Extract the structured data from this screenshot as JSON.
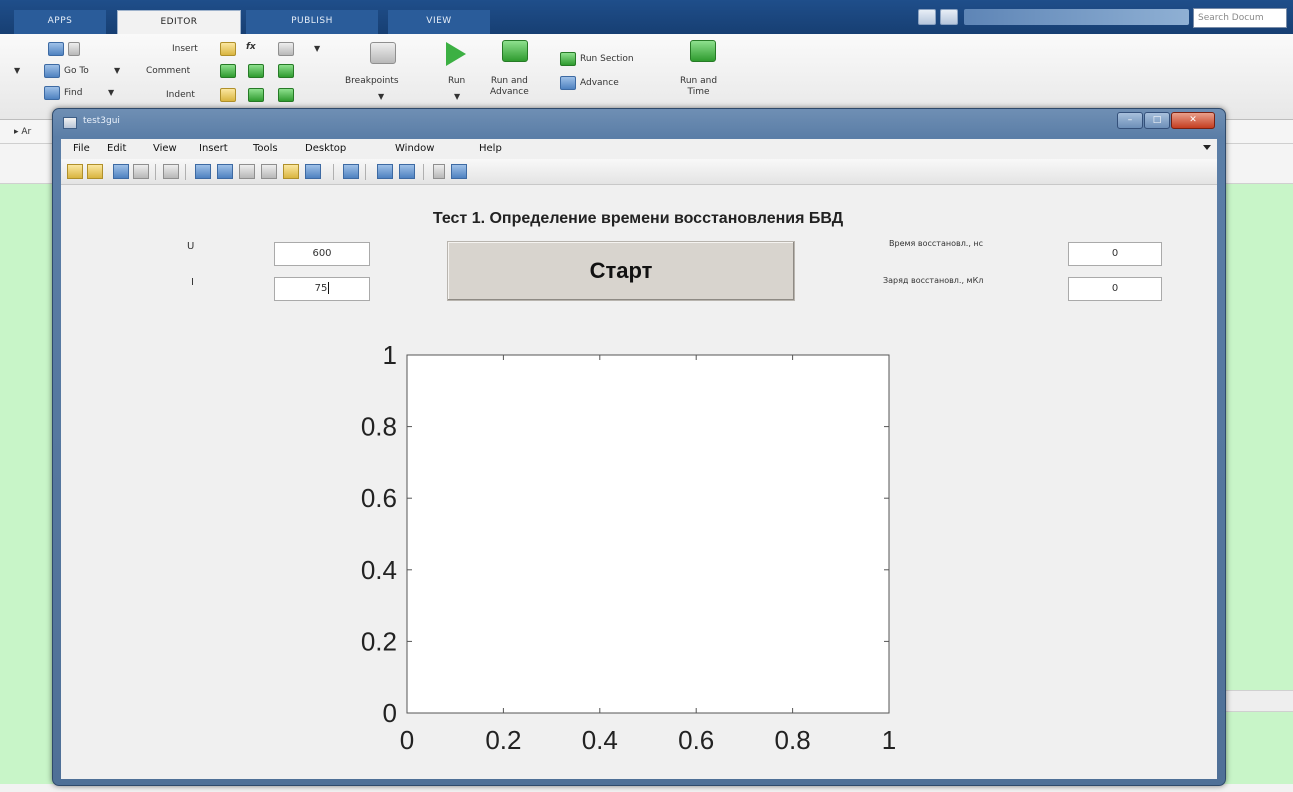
{
  "matlab": {
    "tabs": [
      "APPS",
      "EDITOR",
      "PUBLISH",
      "VIEW"
    ],
    "search_placeholder": "Search Docum",
    "ribbon": {
      "goto_label": "Go To",
      "find_label": "Find",
      "insert_label": "Insert",
      "fx_label": "fx",
      "comment_label": "Comment",
      "indent_label": "Indent",
      "breakpoints_label": "Breakpoints",
      "run_label": "Run",
      "run_and_advance_label": "Run and\nAdvance",
      "run_section_label": "Run Section",
      "advance_label": "Advance",
      "run_and_time_label": "Run and\nTime"
    },
    "address_text": "▸ Ar"
  },
  "figure": {
    "window_title": "test3gui",
    "controls": {
      "minimize": "–",
      "maximize": "□",
      "close": "✕"
    },
    "menu": [
      "File",
      "Edit",
      "View",
      "Insert",
      "Tools",
      "Desktop",
      "Window",
      "Help"
    ],
    "gui": {
      "title": "Тест 1. Определение времени восстановления БВД",
      "u_label": "U",
      "u_value": "600",
      "i_label": "I",
      "i_value": "75",
      "start_label": "Старт",
      "time_label": "Время восстановл., нс",
      "time_value": "0",
      "charge_label": "Заряд восстановл., мКл",
      "charge_value": "0"
    }
  },
  "chart_data": {
    "type": "line",
    "title": "",
    "xlabel": "",
    "ylabel": "",
    "xlim": [
      0,
      1
    ],
    "ylim": [
      0,
      1
    ],
    "x_ticks": [
      "0",
      "0.2",
      "0.4",
      "0.6",
      "0.8",
      "1"
    ],
    "y_ticks": [
      "0",
      "0.2",
      "0.4",
      "0.6",
      "0.8",
      "1"
    ],
    "series": [],
    "grid": false
  },
  "colors": {
    "tabstrip": "#1f4e8a",
    "desktop": "#c8f5c8",
    "figure_bg": "#f0f0f0",
    "button_bg": "#d8d4ce"
  }
}
